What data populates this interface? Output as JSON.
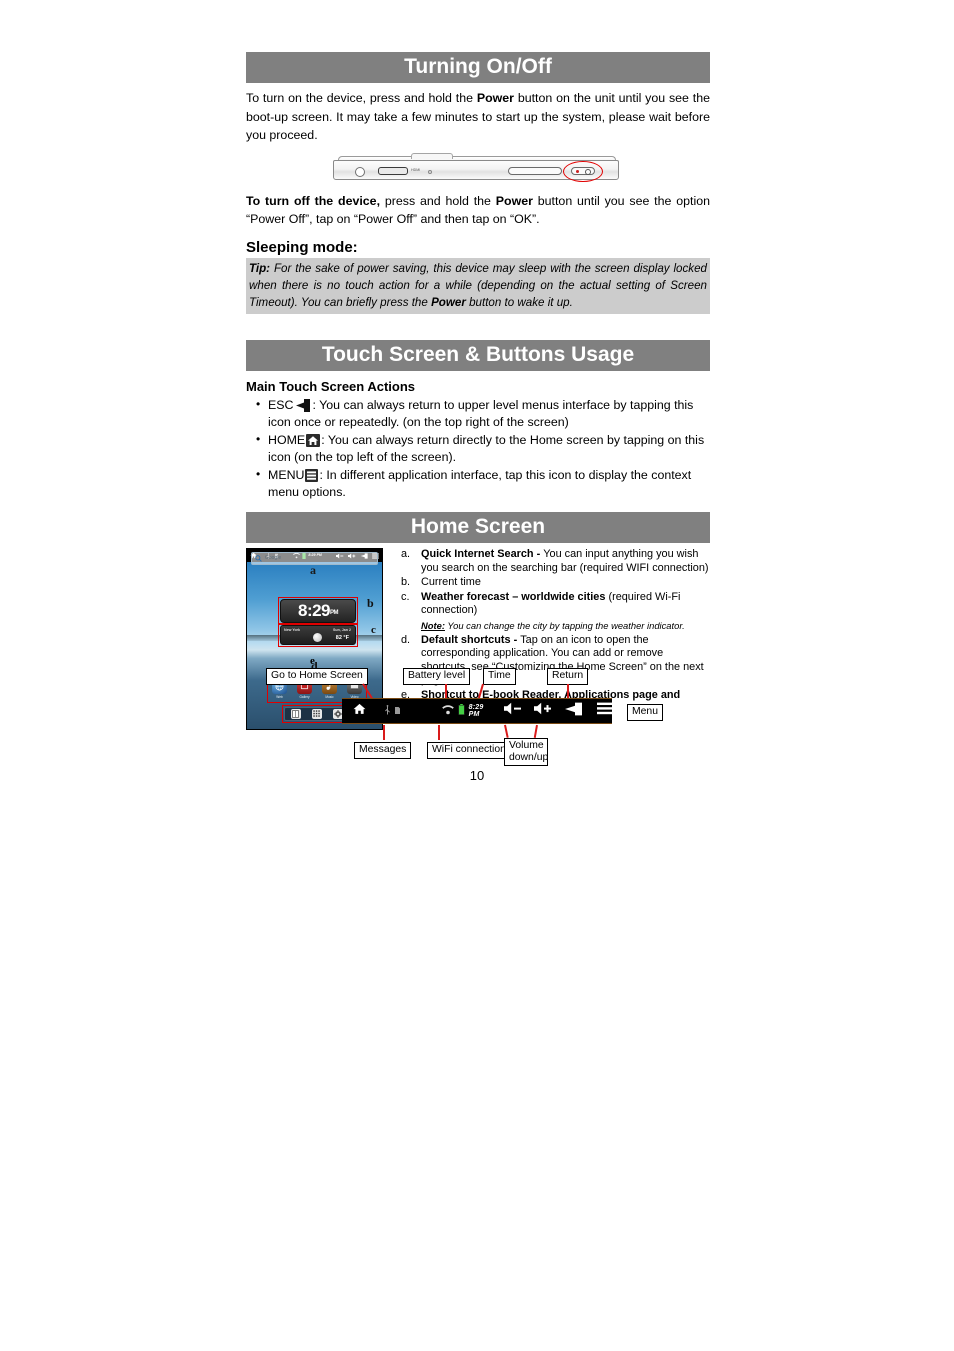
{
  "document": {
    "page_number": "10"
  },
  "sections": {
    "turning_on_off": {
      "title": "Turning On/Off",
      "para1_pre": "To turn on the device, press and hold the ",
      "para1_bold": "Power",
      "para1_post": " button on the unit until you see the boot-up screen. It may take a few minutes to start up the system, please wait before you proceed.",
      "para2_bold1": "To turn off the device,",
      "para2_mid": " press and hold the ",
      "para2_bold2": "Power",
      "para2_post": " button until you see the option “Power Off”, tap on “Power Off” and then tap on “OK”.",
      "device_photo": {
        "hdmi_label": "HDMI"
      }
    },
    "sleeping_mode": {
      "heading": "Sleeping mode:",
      "tip_label": "Tip:",
      "tip_text_1": " For the sake of power saving, this device may sleep with the screen display locked when there is no touch action for a while (depending on the actual setting of Screen Timeout). You can briefly press the ",
      "tip_bold": "Power",
      "tip_text_2": " button to wake it up."
    },
    "touch_screen": {
      "title": "Touch Screen & Buttons Usage",
      "subheading": "Main Touch Screen Actions",
      "bullets": [
        {
          "label": "ESC",
          "icon": "back-arrow-icon",
          "text": ": You can always return to upper level menus interface by tapping this icon once or repeatedly. (on the top right of the screen)"
        },
        {
          "label": "HOME",
          "icon": "home-icon",
          "text": ": You can always return directly to the Home screen by tapping on this icon (on the top left of the screen)."
        },
        {
          "label": "MENU",
          "icon": "menu-list-icon",
          "text": ": In different application interface, tap this icon to display the context menu options."
        }
      ]
    },
    "home_screen": {
      "title": "Home Screen",
      "items": [
        {
          "marker": "a.",
          "bold": "Quick Internet Search - ",
          "text": "You can input anything you wish you search on the searching bar (required WIFI connection)"
        },
        {
          "marker": "b.",
          "bold": "",
          "text": "Current time"
        },
        {
          "marker": "c.",
          "bold": "Weather forecast – worldwide cities ",
          "text": "(required Wi-Fi connection)",
          "note_label": "Note:",
          "note_text": " You can change the city by tapping the weather indicator."
        },
        {
          "marker": "d.",
          "bold": "Default shortcuts - ",
          "text": "Tap on an icon to open the corresponding application. You can add or remove shortcuts, see “Customizing the Home Screen” on the next page."
        },
        {
          "marker": "e.",
          "bold": "Shortcut to E-book Reader, Applications page and System Settings",
          "text": ""
        }
      ],
      "screenshot": {
        "search_placeholder": "Google",
        "clock_time": "8:29",
        "clock_ampm": "PM",
        "weather_city": "New York",
        "weather_date": "Sun, Jan 2",
        "weather_temp": "82 °F",
        "labels": {
          "a": "a",
          "b": "b",
          "c": "c",
          "d": "d",
          "e": "e"
        },
        "shortcuts": [
          {
            "name": "Web",
            "icon": "browser-icon"
          },
          {
            "name": "Gallery",
            "icon": "gallery-icon"
          },
          {
            "name": "Music",
            "icon": "music-icon"
          },
          {
            "name": "Video",
            "icon": "video-icon"
          }
        ],
        "dock": [
          {
            "name": "ebook",
            "icon": "ebook-reader-icon"
          },
          {
            "name": "apps",
            "icon": "applications-grid-icon"
          },
          {
            "name": "settings",
            "icon": "settings-gear-icon"
          }
        ]
      }
    },
    "status_bar_callouts": {
      "status_time": "8:29 PM",
      "boxes": [
        {
          "id": "home",
          "label": "Go to Home Screen"
        },
        {
          "id": "battery",
          "label": "Battery level"
        },
        {
          "id": "time",
          "label": "Time"
        },
        {
          "id": "return",
          "label": "Return"
        },
        {
          "id": "menu",
          "label": "Menu"
        },
        {
          "id": "messages",
          "label": "Messages"
        },
        {
          "id": "wifi",
          "label": "WiFi connection"
        },
        {
          "id": "volume",
          "label": "Volume\ndown/up"
        }
      ],
      "volume_label_line1": "Volume",
      "volume_label_line2": "down/up"
    }
  },
  "colors": {
    "section_bar": "#808080",
    "tip_background": "#cccccc",
    "callout_line": "#d91a1a",
    "highlight_circle": "#e00000"
  }
}
